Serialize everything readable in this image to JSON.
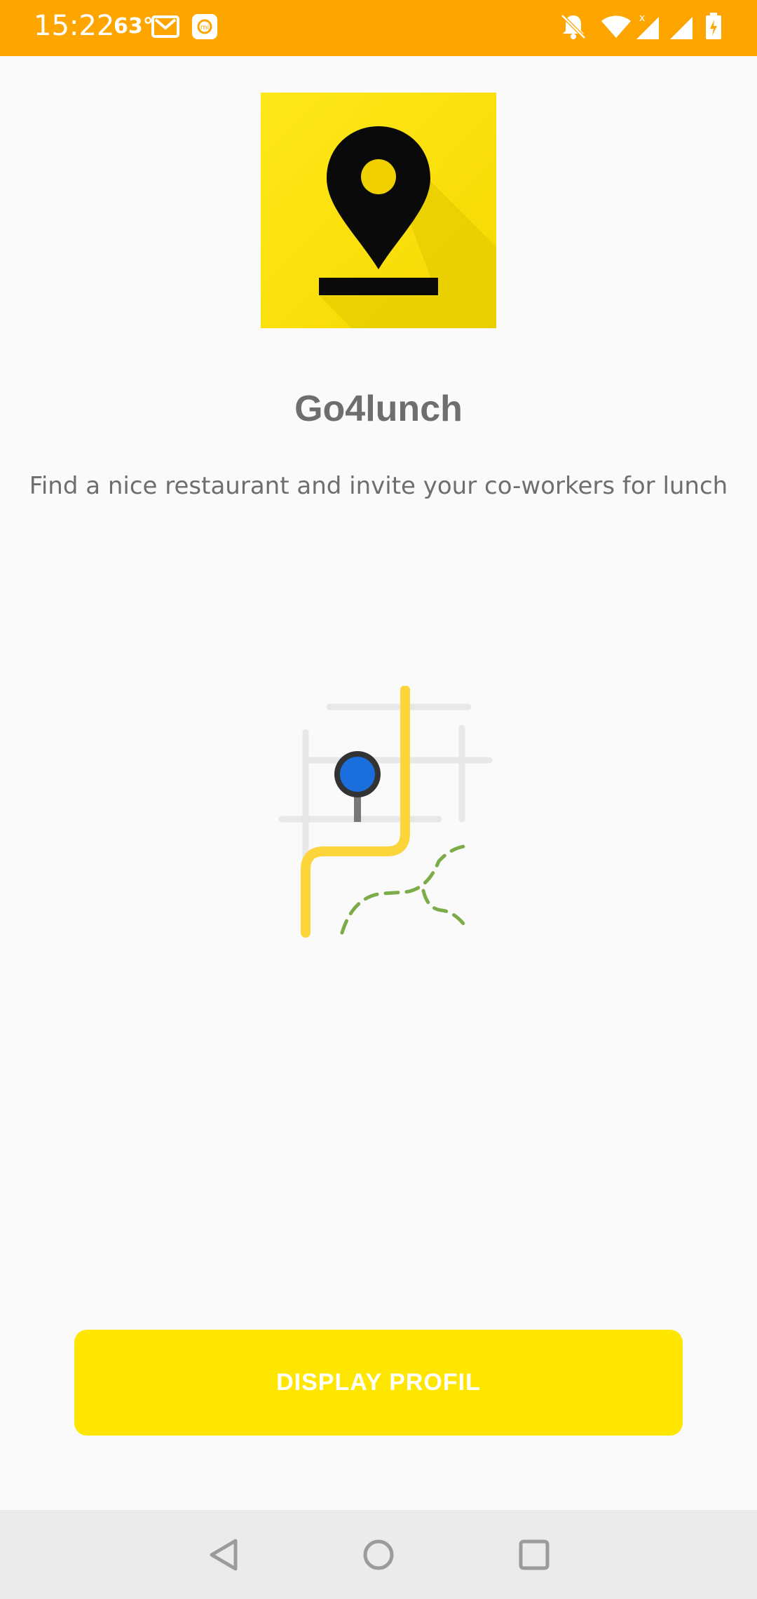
{
  "status_bar": {
    "time": "15:22",
    "temperature": "63°",
    "background_color": "#ffa500",
    "icons": [
      "gmail-icon",
      "mi-icon",
      "notifications-off-icon",
      "wifi-icon",
      "signal-icon",
      "signal-icon",
      "battery-charging-icon"
    ]
  },
  "app": {
    "logo_icon": "map-pin-icon",
    "title": "Go4lunch",
    "subtitle": "Find a nice restaurant and invite your co-workers for lunch",
    "illustration": "map-route-illustration"
  },
  "actions": {
    "display_profil_label": "DISPLAY PROFIL",
    "button_color": "#ffe600"
  },
  "nav_bar": {
    "icons": [
      "back-icon",
      "home-icon",
      "recents-icon"
    ]
  }
}
